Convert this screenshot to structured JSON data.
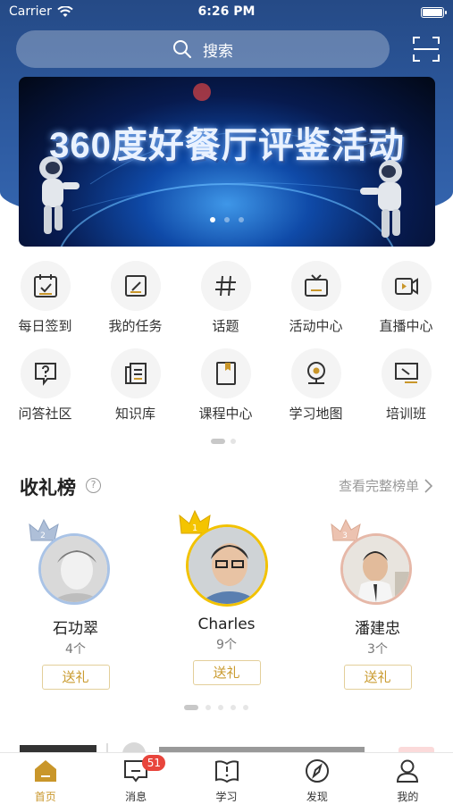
{
  "status_bar": {
    "carrier": "Carrier",
    "time": "6:26 PM"
  },
  "search": {
    "placeholder": "搜索"
  },
  "banner": {
    "title": "360度好餐厅评鉴活动",
    "dots": 3,
    "active_dot": 0
  },
  "grid": {
    "items": [
      {
        "label": "每日签到",
        "icon": "calendar-check-icon"
      },
      {
        "label": "我的任务",
        "icon": "task-edit-icon"
      },
      {
        "label": "话题",
        "icon": "hashtag-icon"
      },
      {
        "label": "活动中心",
        "icon": "tv-icon"
      },
      {
        "label": "直播中心",
        "icon": "video-camera-icon"
      },
      {
        "label": "问答社区",
        "icon": "question-icon"
      },
      {
        "label": "知识库",
        "icon": "book-icon"
      },
      {
        "label": "课程中心",
        "icon": "course-book-icon"
      },
      {
        "label": "学习地图",
        "icon": "map-pin-icon"
      },
      {
        "label": "培训班",
        "icon": "presentation-icon"
      }
    ]
  },
  "gift_board": {
    "title": "收礼榜",
    "help": "?",
    "more_label": "查看完整榜单",
    "button_label": "送礼",
    "ranks": [
      {
        "rank": 2,
        "name": "石功翠",
        "count": "4个"
      },
      {
        "rank": 1,
        "name": "Charles",
        "count": "9个"
      },
      {
        "rank": 3,
        "name": "潘建忠",
        "count": "3个"
      }
    ]
  },
  "tabbar": {
    "tabs": [
      {
        "label": "首页",
        "icon": "home-icon",
        "active": true
      },
      {
        "label": "消息",
        "icon": "message-icon",
        "badge": "51"
      },
      {
        "label": "学习",
        "icon": "study-book-icon"
      },
      {
        "label": "发现",
        "icon": "compass-icon"
      },
      {
        "label": "我的",
        "icon": "profile-icon"
      }
    ]
  },
  "colors": {
    "header": "#2d5aa0",
    "accent": "#c9962a",
    "badge": "#e8453c",
    "gold": "#f2c200"
  }
}
